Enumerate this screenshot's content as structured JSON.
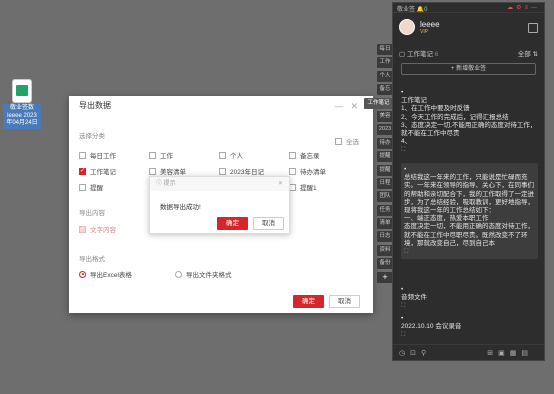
{
  "desktop": {
    "icon_label_1": "敬业签数",
    "icon_label_2": "leeee 2023",
    "icon_label_3": "年04月24日"
  },
  "export_dialog": {
    "title": "导出数据",
    "category_label": "选择分类",
    "select_all": "全选",
    "categories": [
      {
        "label": "每日工作",
        "checked": false
      },
      {
        "label": "工作",
        "checked": false
      },
      {
        "label": "个人",
        "checked": false
      },
      {
        "label": "备忘录",
        "checked": false
      },
      {
        "label": "工作笔记",
        "checked": true
      },
      {
        "label": "美容清单",
        "checked": false
      },
      {
        "label": "2023年日记",
        "checked": false
      },
      {
        "label": "待办清单",
        "checked": false
      },
      {
        "label": "提醒",
        "checked": false
      },
      {
        "label": "",
        "checked": false
      },
      {
        "label": "",
        "checked": false
      },
      {
        "label": "提醒1",
        "checked": false
      }
    ],
    "content_label": "导出内容",
    "content_option": "文字内容",
    "format_label": "导出格式",
    "format_excel": "导出Excel表格",
    "format_folder": "导出文件夹格式",
    "confirm": "确定",
    "cancel": "取消"
  },
  "popup": {
    "title": "提示",
    "message": "数据导出成功!",
    "confirm": "确定",
    "cancel": "取消"
  },
  "panel": {
    "app_name": "敬业签",
    "notif_count": "0",
    "username": "leeee",
    "vip": "VIP",
    "notebook_title": "工作笔记",
    "notebook_count": "6",
    "filter": "全部",
    "new_note": "+ 新增敬业签",
    "notes": [
      {
        "text": "工作笔记\n1、在工作中要及时反馈\n2、今天工作的完成后，记得汇报总结\n3、态度决定一切,不能用正确的态度对待工作，就不能在工作中尽责\n4、"
      },
      {
        "text": "总结我这一年来的工作，只能说是忙碌而充实。一年来在领导的指导、关心下，在同事们的帮助和亲切配合下，我的工作取得了一定进步，为了总结经验，吸取教训，更好地指导，现将我这一年的工作总结如下：\n一、端正态度，热爱本职工作\n态度决定一切，不能用正确的态度对待工作，就不能在工作中尽职尽责。既然改变不了环境，那就改变自己，尽到自己本"
      },
      {
        "text": "音频文件"
      },
      {
        "text": "2022.10.10 会议录音"
      }
    ]
  },
  "tabs": [
    "每日",
    "工作",
    "个人",
    "备忘",
    "工作笔记",
    "美容",
    "2023",
    "待办",
    "提醒",
    "提醒",
    "日程",
    "团队",
    "任务",
    "清单",
    "日志",
    "资料",
    "备份"
  ]
}
